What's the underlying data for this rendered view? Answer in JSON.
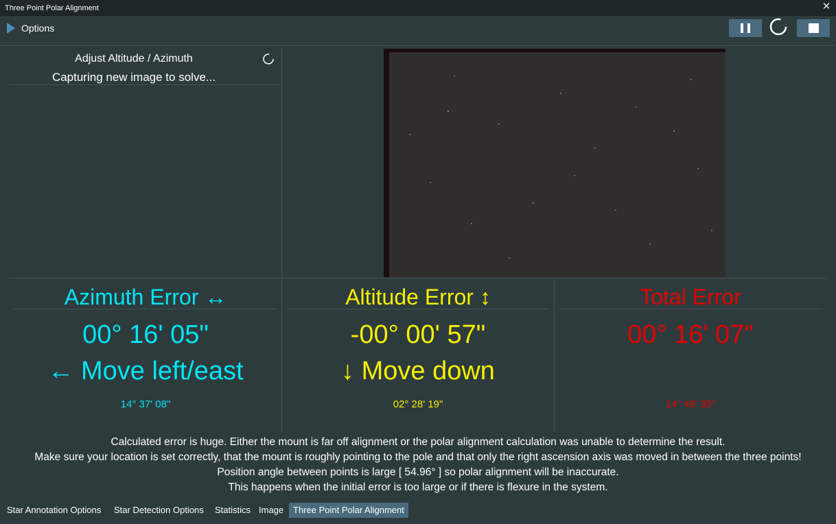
{
  "window": {
    "title": "Three Point Polar Alignment"
  },
  "toolbar": {
    "options_label": "Options"
  },
  "status": {
    "title": "Adjust Altitude / Azimuth",
    "subtitle": "Capturing new image to solve..."
  },
  "azimuth": {
    "heading": "Azimuth Error ↔",
    "value": "00° 16' 05\"",
    "move": "← Move left/east",
    "detail": "14° 37' 08\"",
    "color": "#00e5f2"
  },
  "altitude": {
    "heading": "Altitude Error ↕",
    "value": "-00° 00' 57\"",
    "move": "↓ Move down",
    "detail": "02° 28' 19\"",
    "color": "#f5f000"
  },
  "total": {
    "heading": "Total Error",
    "value": "00° 16' 07\"",
    "detail": "14° 49' 35\"",
    "color": "#e00000"
  },
  "messages": [
    "Calculated error is huge. Either the mount is far off alignment or the polar alignment calculation was unable to determine the result.",
    "Make sure your location is set correctly, that the mount is roughly pointing to the pole and that only the right ascension axis was moved in between the three points!",
    "Position angle between points is large [ 54.96° ] so polar alignment will be inaccurate.",
    "This happens when the initial error is too large or if there is flexure in the system."
  ],
  "tabs": [
    {
      "label": "Star Annotation Options",
      "active": false
    },
    {
      "label": "Star Detection Options",
      "active": false
    },
    {
      "label": "Statistics",
      "active": false
    },
    {
      "label": "Image",
      "active": false
    },
    {
      "label": "Three Point Polar Alignment",
      "active": true
    }
  ]
}
